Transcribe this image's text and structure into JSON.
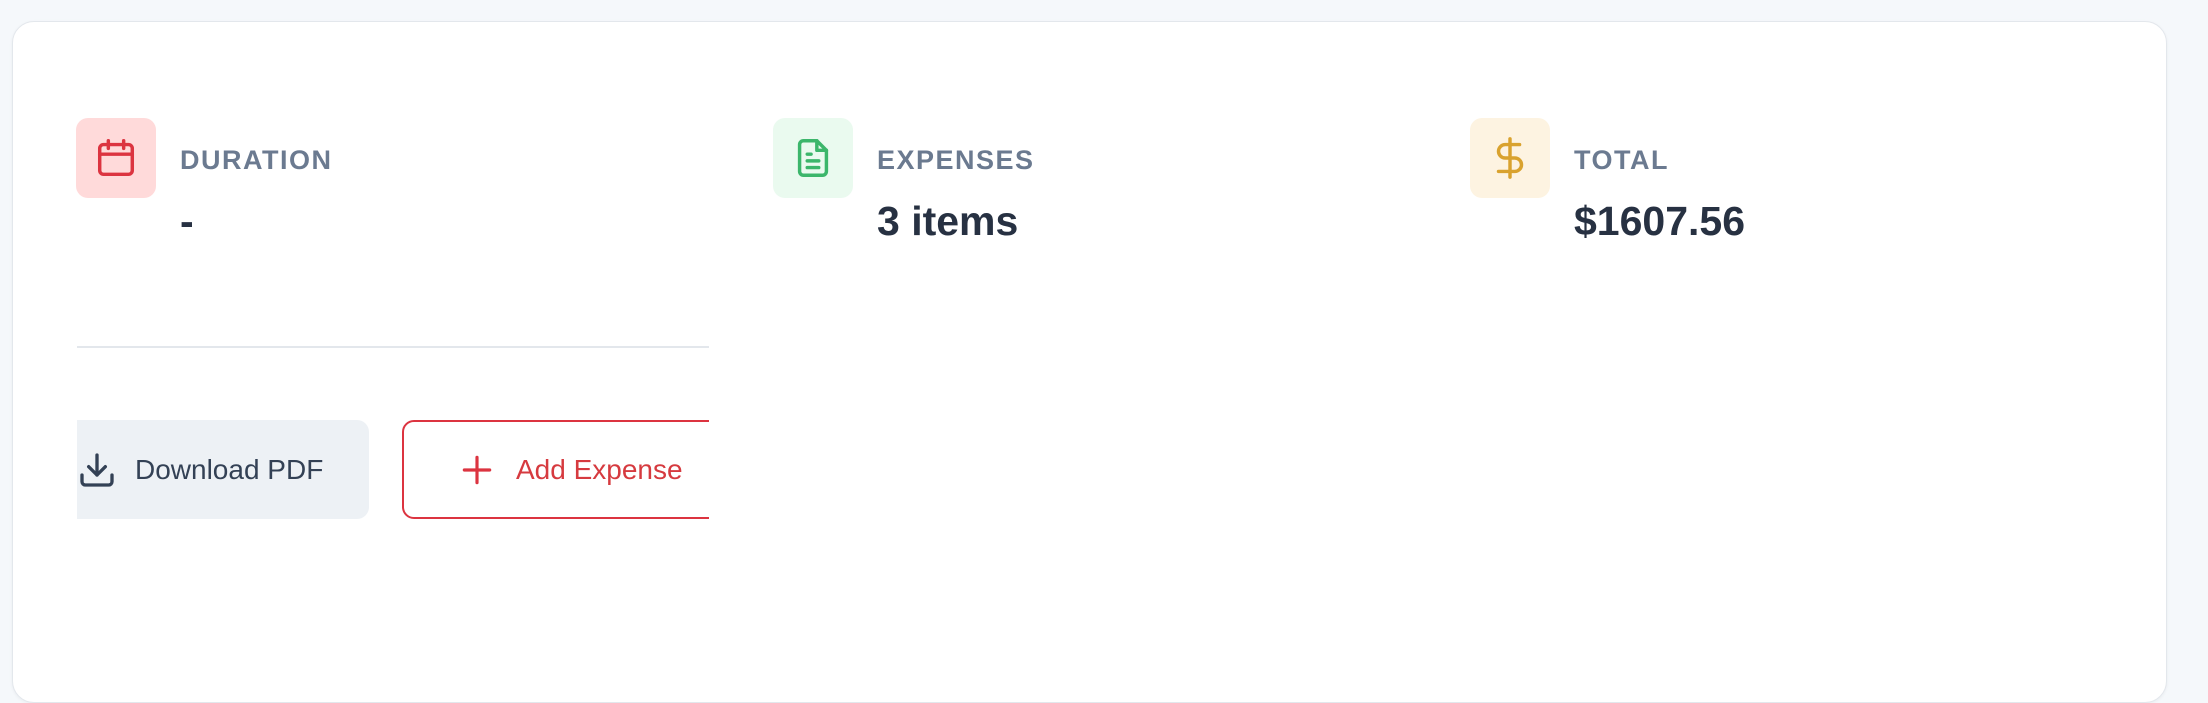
{
  "summary": {
    "duration": {
      "label": "DURATION",
      "value": "-",
      "icon": "calendar-icon",
      "icon_color": "#dc3440",
      "icon_bg": "#ffdada"
    },
    "expenses": {
      "label": "EXPENSES",
      "value": "3 items",
      "icon": "document-icon",
      "icon_color": "#3cb66b",
      "icon_bg": "#eafaef"
    },
    "total": {
      "label": "TOTAL",
      "value": "$1607.56",
      "icon": "dollar-icon",
      "icon_color": "#d9a22e",
      "icon_bg": "#fdf3e1"
    }
  },
  "actions": {
    "download_label": "Download PDF",
    "download_icon": "download-icon",
    "add_label": "Add Expense",
    "add_icon": "plus-icon",
    "accent": "#dc3440"
  }
}
